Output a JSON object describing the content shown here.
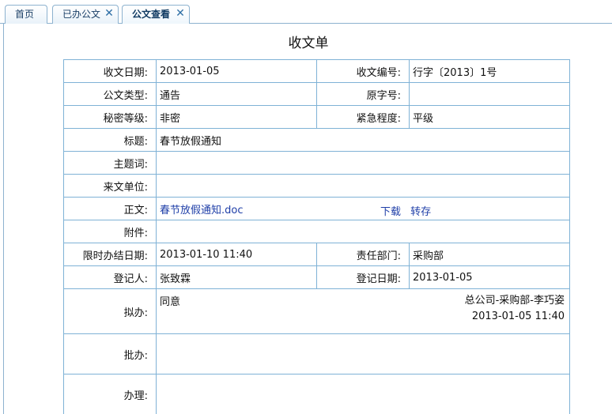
{
  "tabs": [
    {
      "label": "首页"
    },
    {
      "label": "已办公文",
      "close": "✕"
    },
    {
      "label": "公文查看",
      "close": "✕"
    }
  ],
  "form": {
    "title": "收文单",
    "receive_date_label": "收文日期:",
    "receive_date": "2013-01-05",
    "receive_no_label": "收文编号:",
    "receive_no": "行字〔2013〕1号",
    "doc_type_label": "公文类型:",
    "doc_type": "通告",
    "orig_no_label": "原字号:",
    "orig_no": "",
    "secret_label": "秘密等级:",
    "secret": "非密",
    "urgency_label": "紧急程度:",
    "urgency": "平级",
    "subject_label": "标题:",
    "subject": "春节放假通知",
    "keywords_label": "主题词:",
    "keywords": "",
    "source_label": "来文单位:",
    "source": "",
    "body_label": "正文:",
    "body_file": "春节放假通知.doc",
    "download_label": "下载",
    "save_label": "转存",
    "attach_label": "附件:",
    "attach": "",
    "deadline_label": "限时办结日期:",
    "deadline": "2013-01-10 11:40",
    "dept_label": "责任部门:",
    "dept": "采购部",
    "registrar_label": "登记人:",
    "registrar": "张致霖",
    "reg_date_label": "登记日期:",
    "reg_date": "2013-01-05",
    "draft_label": "拟办:",
    "draft_opinion": "同意",
    "draft_by": "总公司-采购部-李巧姿",
    "draft_time": "2013-01-05 11:40",
    "approve_label": "批办:",
    "handle_label": "办理:"
  }
}
